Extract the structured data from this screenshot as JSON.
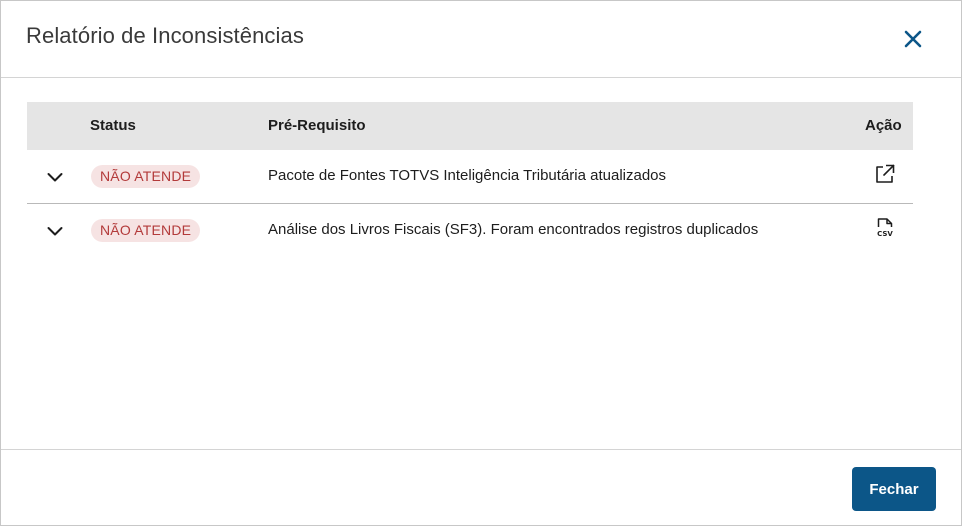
{
  "modal": {
    "title": "Relatório de Inconsistências",
    "close_icon": "close-icon"
  },
  "table": {
    "columns": {
      "status": "Status",
      "prerequisite": "Pré-Requisito",
      "action": "Ação"
    },
    "rows": [
      {
        "expand_icon": "chevron-down-icon",
        "status": "NÃO ATENDE",
        "prerequisite": "Pacote de Fontes TOTVS Inteligência Tributária atualizados",
        "action_icon": "external-link-icon"
      },
      {
        "expand_icon": "chevron-down-icon",
        "status": "NÃO ATENDE",
        "prerequisite": "Análise dos Livros Fiscais (SF3). Foram encontrados registros duplicados",
        "action_icon": "csv-file-icon"
      }
    ]
  },
  "footer": {
    "close_label": "Fechar"
  },
  "colors": {
    "primary": "#0c5688",
    "badge_bg": "#f6e3e3",
    "badge_text": "#b33a3a",
    "header_bg": "#e5e5e5"
  }
}
